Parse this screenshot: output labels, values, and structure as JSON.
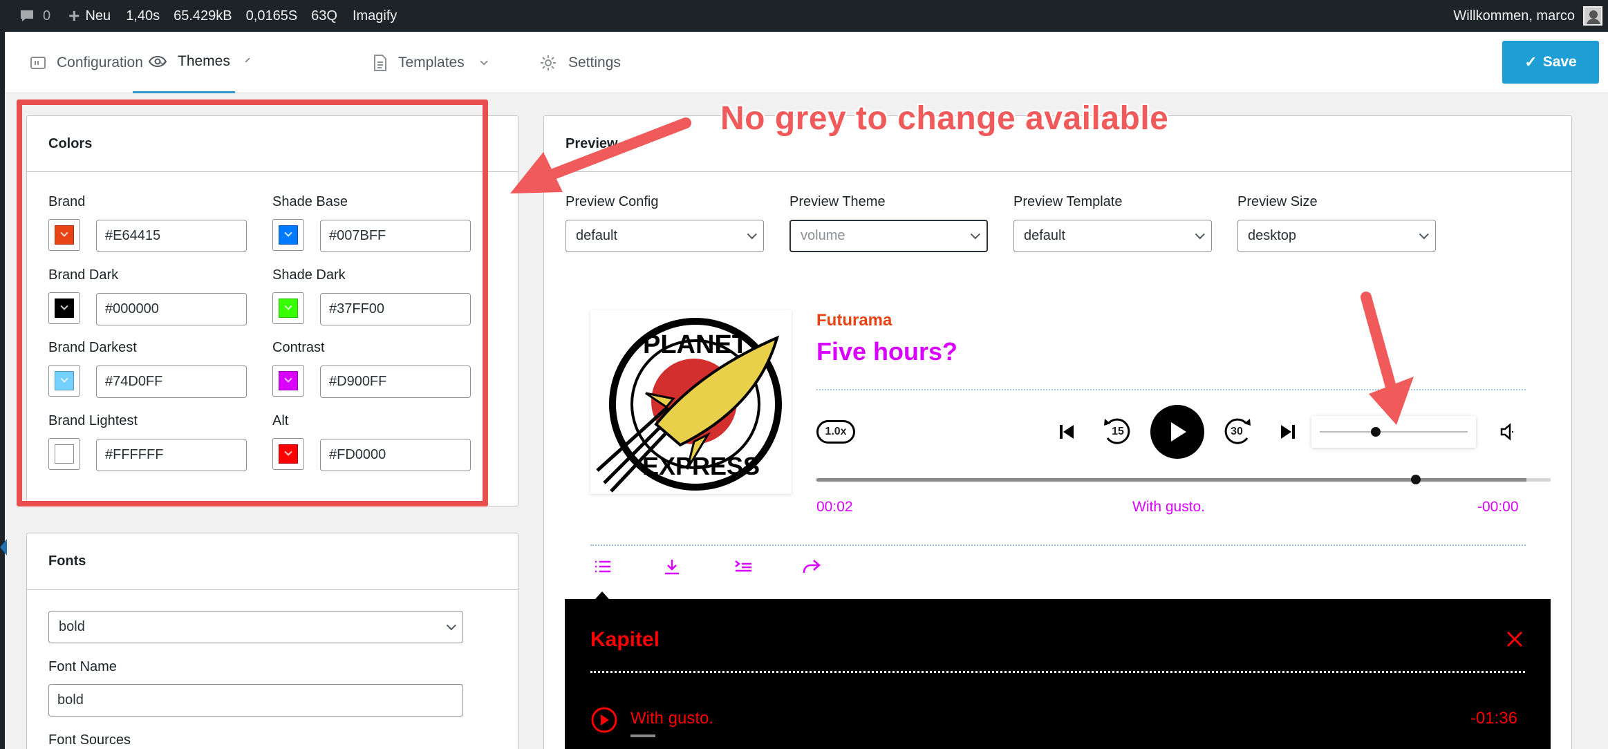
{
  "adminbar": {
    "comments_count": "0",
    "new_label": "Neu",
    "stat_time": "1,40s",
    "stat_memory": "65.429kB",
    "stat_query_time": "0,0165S",
    "stat_queries": "63Q",
    "plugin": "Imagify",
    "welcome": "Willkommen, marco"
  },
  "nav": {
    "tabs": [
      {
        "label": "Configuration"
      },
      {
        "label": "Themes"
      },
      {
        "label": "Templates"
      },
      {
        "label": "Settings"
      }
    ],
    "active_tab": "Themes",
    "save_label": "Save"
  },
  "colors": {
    "title": "Colors",
    "fields": [
      {
        "label": "Brand",
        "value": "#E64415",
        "swatch": "#E64415"
      },
      {
        "label": "Shade Base",
        "value": "#007BFF",
        "swatch": "#007BFF"
      },
      {
        "label": "Brand Dark",
        "value": "#000000",
        "swatch": "#000000"
      },
      {
        "label": "Shade Dark",
        "value": "#37FF00",
        "swatch": "#37FF00"
      },
      {
        "label": "Brand Darkest",
        "value": "#74D0FF",
        "swatch": "#74D0FF"
      },
      {
        "label": "Contrast",
        "value": "#D900FF",
        "swatch": "#D900FF"
      },
      {
        "label": "Brand Lightest",
        "value": "#FFFFFF",
        "swatch": "#FFFFFF"
      },
      {
        "label": "Alt",
        "value": "#FD0000",
        "swatch": "#FD0000"
      }
    ]
  },
  "fonts": {
    "title": "Fonts",
    "select_value": "bold",
    "font_name_label": "Font Name",
    "font_name_value": "bold",
    "font_sources_label": "Font Sources"
  },
  "preview": {
    "title": "Preview",
    "selects": [
      {
        "label": "Preview Config",
        "value": "default"
      },
      {
        "label": "Preview Theme",
        "value": "volume"
      },
      {
        "label": "Preview Template",
        "value": "default"
      },
      {
        "label": "Preview Size",
        "value": "desktop"
      }
    ]
  },
  "player": {
    "show_title": "Futurama",
    "episode_title": "Five hours?",
    "cover_text_top": "PLANET",
    "cover_text_bottom": "EXPRESS",
    "speed": "1.0x",
    "rewind_seconds": "15",
    "forward_seconds": "30",
    "volume_level": 0.38,
    "progress": 0.96,
    "time_elapsed": "00:02",
    "chapter_current": "With gusto.",
    "time_remaining": "-00:00",
    "chapters_title": "Kapitel",
    "chapters": [
      {
        "title": "With gusto.",
        "time": "-01:36"
      }
    ]
  },
  "annotation": {
    "text": "No grey to change available"
  },
  "theme_colors": {
    "accent": "#1d9fd6",
    "annotation": "#e94f4f"
  }
}
